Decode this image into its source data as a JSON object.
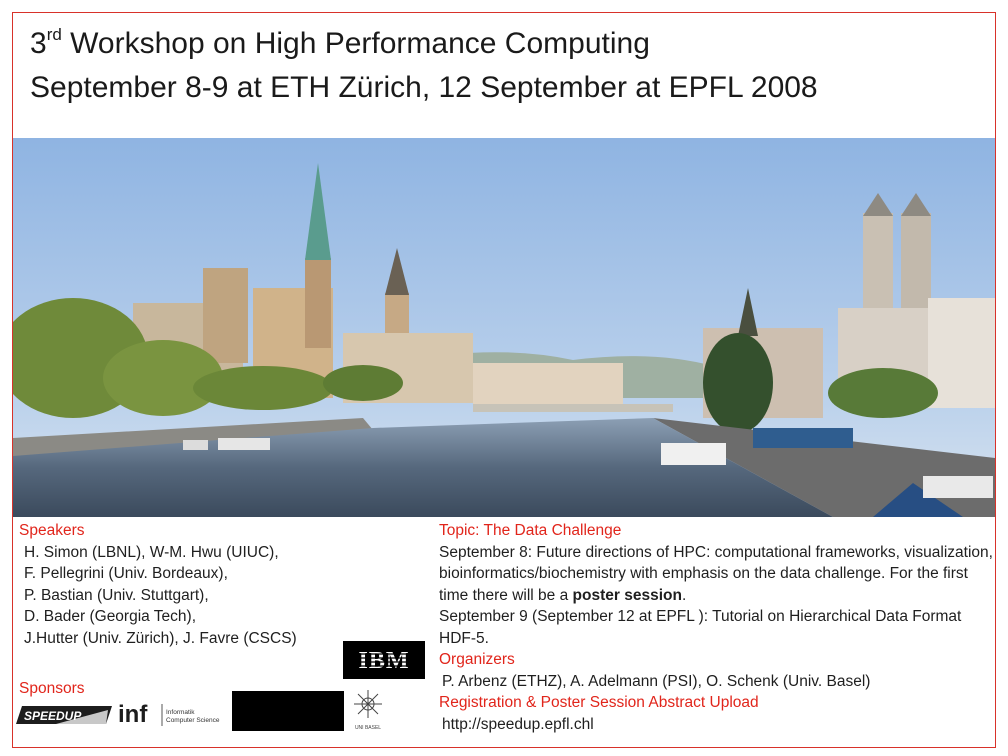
{
  "title": {
    "line1_number": "3",
    "line1_sup": "rd",
    "line1_rest": " Workshop on High Performance Computing",
    "line2": "September 8-9 at ETH Zürich, 12 September at EPFL 2008"
  },
  "speakers": {
    "heading": "Speakers",
    "lines": [
      "H. Simon (LBNL), W-M. Hwu (UIUC),",
      "F. Pellegrini (Univ. Bordeaux),",
      "P. Bastian (Univ. Stuttgart),",
      "D. Bader (Georgia Tech),",
      "J.Hutter (Univ. Zürich), J. Favre (CSCS)"
    ]
  },
  "sponsors": {
    "heading": "Sponsors",
    "logo_speedup": "SPEEDUP",
    "logo_inf": "inf",
    "logo_inf_sub1": "Informatik",
    "logo_inf_sub2": "Computer Science",
    "logo_ibm": "IBM",
    "logo_basel": "UNI BASEL"
  },
  "topic": {
    "heading": "Topic:  The Data Challenge",
    "sept8_pre": "September 8: Future directions of HPC: computational frameworks, visualization, bioinformatics/biochemistry with emphasis on the data challenge. For the first time there will be a ",
    "sept8_bold": "poster session",
    "sept8_post": ".",
    "sept9": "September 9 (September 12 at EPFL ): Tutorial on  Hierarchical Data Format HDF-5."
  },
  "organizers": {
    "heading": "Organizers",
    "text": "P. Arbenz (ETHZ), A. Adelmann (PSI), O. Schenk (Univ. Basel)"
  },
  "registration": {
    "heading": "Registration & Poster Session Abstract Upload",
    "url": "http://speedup.epfl.chl"
  },
  "colors": {
    "accent_red": "#e1251b",
    "border_red": "#d8322a",
    "text": "#1f1f1f"
  }
}
